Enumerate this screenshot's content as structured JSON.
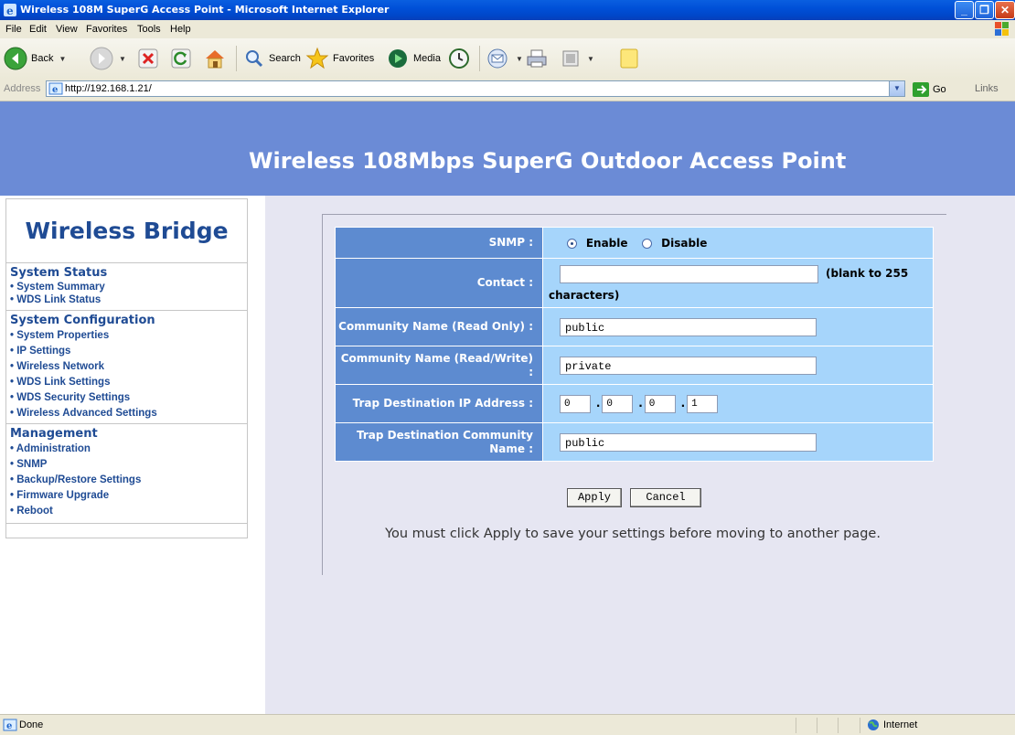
{
  "window": {
    "title": "Wireless 108M SuperG Access Point - Microsoft Internet Explorer"
  },
  "menu": [
    "File",
    "Edit",
    "View",
    "Favorites",
    "Tools",
    "Help"
  ],
  "toolbar": {
    "back": "Back",
    "search": "Search",
    "favorites": "Favorites",
    "media": "Media"
  },
  "address": {
    "label": "Address",
    "url": "http://192.168.1.21/",
    "go": "Go",
    "links": "Links"
  },
  "page": {
    "heading": "Wireless 108Mbps SuperG Outdoor Access Point"
  },
  "sidebar": {
    "brand": "Wireless Bridge",
    "sections": [
      {
        "title": "System Status",
        "items": [
          "System Summary",
          "WDS Link Status"
        ]
      },
      {
        "title": "System Configuration",
        "items": [
          "System Properties",
          "IP Settings",
          "Wireless Network",
          "WDS Link Settings",
          "WDS Security Settings",
          "Wireless Advanced Settings"
        ]
      },
      {
        "title": "Management",
        "items": [
          "Administration",
          "SNMP",
          "Backup/Restore Settings",
          "Firmware Upgrade",
          "Reboot"
        ]
      }
    ]
  },
  "form": {
    "snmp_label": "SNMP :",
    "snmp_enable": "Enable",
    "snmp_disable": "Disable",
    "snmp_selected": "Enable",
    "contact_label": "Contact :",
    "contact_value": "",
    "contact_hint": "(blank to 255",
    "contact_hint2": "characters)",
    "community_ro_label": "Community Name (Read Only) :",
    "community_ro_value": "public",
    "community_rw_label": "Community Name (Read/Write) :",
    "community_rw_value": "private",
    "trap_ip_label": "Trap Destination IP Address :",
    "trap_ip": [
      "0",
      "0",
      "0",
      "1"
    ],
    "trap_community_label": "Trap Destination Community Name :",
    "trap_community_value": "public",
    "apply": "Apply",
    "cancel": "Cancel",
    "notice": "You must click Apply to save your settings before moving to another page."
  },
  "status": {
    "text": "Done",
    "zone": "Internet"
  }
}
